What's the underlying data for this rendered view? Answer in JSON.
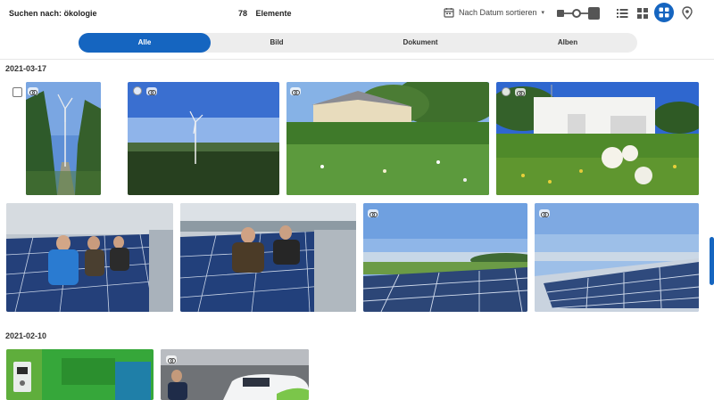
{
  "header": {
    "search_label": "Suchen nach: ökologie",
    "count": "78",
    "count_unit": "Elemente",
    "sort_label": "Nach Datum sortieren"
  },
  "tabs": [
    {
      "label": "Alle",
      "active": true
    },
    {
      "label": "Bild",
      "active": false
    },
    {
      "label": "Dokument",
      "active": false
    },
    {
      "label": "Alben",
      "active": false
    }
  ],
  "groups": [
    {
      "date": "2021-03-17"
    },
    {
      "date": "2021-02-10"
    }
  ],
  "colors": {
    "accent": "#1565c0",
    "tab_bg": "#ededed"
  },
  "icons": [
    "calendar-icon",
    "sort-caret-icon",
    "thumbnail-size-slider",
    "list-view-icon",
    "grid-small-view-icon",
    "grid-large-view-icon",
    "map-pin-icon",
    "vr-360-icon"
  ]
}
